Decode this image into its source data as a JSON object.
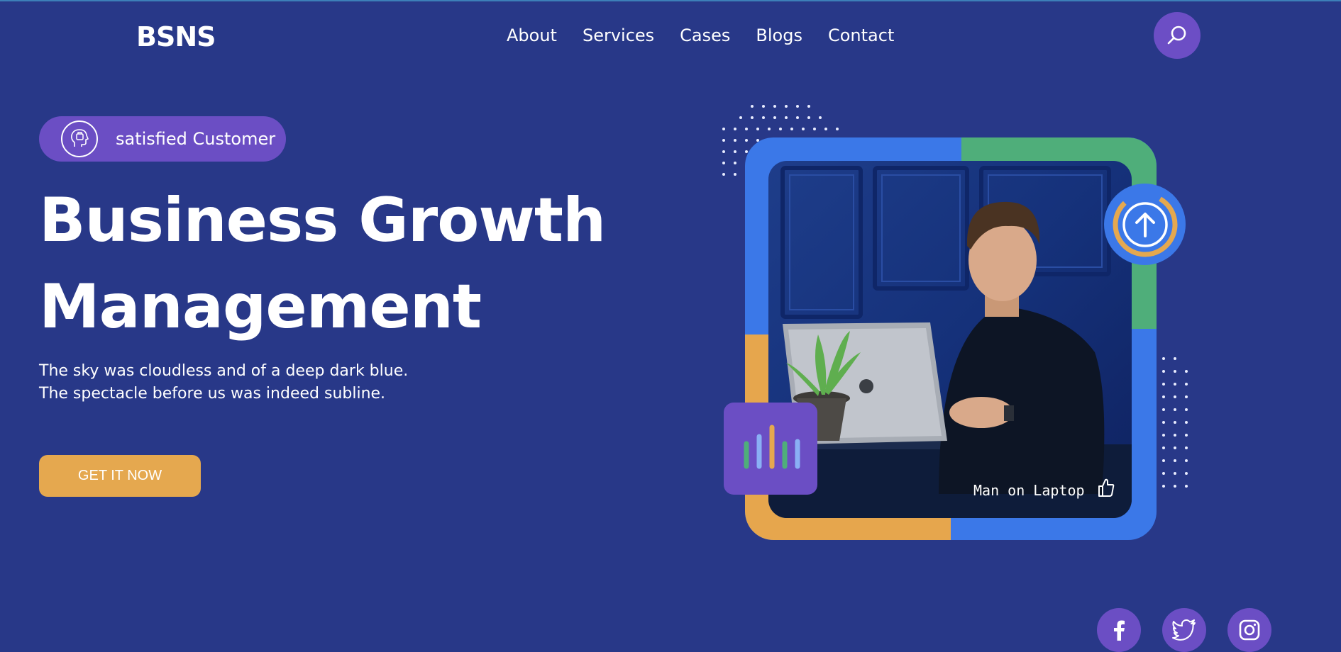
{
  "header": {
    "logo": "BSNS",
    "nav": [
      "About",
      "Services",
      "Cases",
      "Blogs",
      "Contact"
    ]
  },
  "hero": {
    "badge_text": "satisfied Customer",
    "headline": [
      "Business Growth",
      "Management"
    ],
    "description": [
      "The sky was cloudless and of a deep dark blue.",
      "The spectacle before us was indeed subline."
    ],
    "cta_label": "GET IT NOW",
    "image_caption": "Man on Laptop"
  },
  "colors": {
    "background": "#283888",
    "accent_purple": "#6b4ec4",
    "accent_orange": "#e5a84f",
    "accent_blue": "#3b78e8",
    "accent_green": "#4fae7a"
  },
  "icons": {
    "search": "search-icon",
    "badge": "customer-head-icon",
    "upload": "arrow-up-circle-icon",
    "like": "thumbs-up-icon",
    "stats": "bar-chart-icon",
    "social": [
      "facebook-icon",
      "twitter-icon",
      "instagram-icon"
    ]
  }
}
